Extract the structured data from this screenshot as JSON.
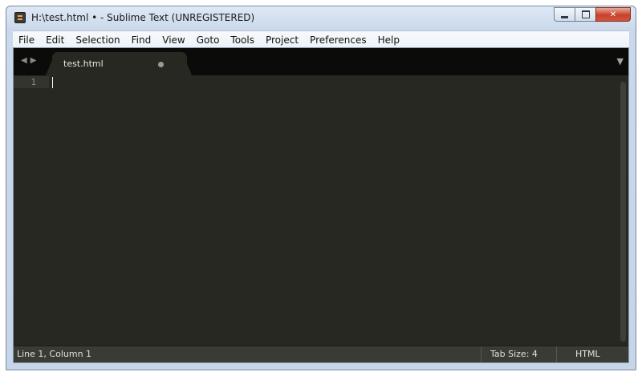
{
  "window": {
    "title": "H:\\test.html • - Sublime Text (UNREGISTERED)"
  },
  "window_controls": {
    "close_glyph": "✕"
  },
  "menu": [
    "File",
    "Edit",
    "Selection",
    "Find",
    "View",
    "Goto",
    "Tools",
    "Project",
    "Preferences",
    "Help"
  ],
  "tabs": {
    "nav_back": "◀",
    "nav_forward": "▶",
    "active_tab": "test.html",
    "dropdown": "▼"
  },
  "editor": {
    "line_numbers": [
      "1"
    ]
  },
  "status": {
    "position": "Line 1, Column 1",
    "tab_size": "Tab Size: 4",
    "syntax": "HTML"
  },
  "colors": {
    "editor_bg": "#272822",
    "tab_strip": "#0b0b0a",
    "status_bg": "#3a3b35"
  },
  "icons": [
    "sublime-app-icon",
    "minimize-icon",
    "maximize-icon",
    "close-icon",
    "back-arrow-icon",
    "forward-arrow-icon",
    "unsaved-dot-icon",
    "tab-dropdown-icon"
  ]
}
